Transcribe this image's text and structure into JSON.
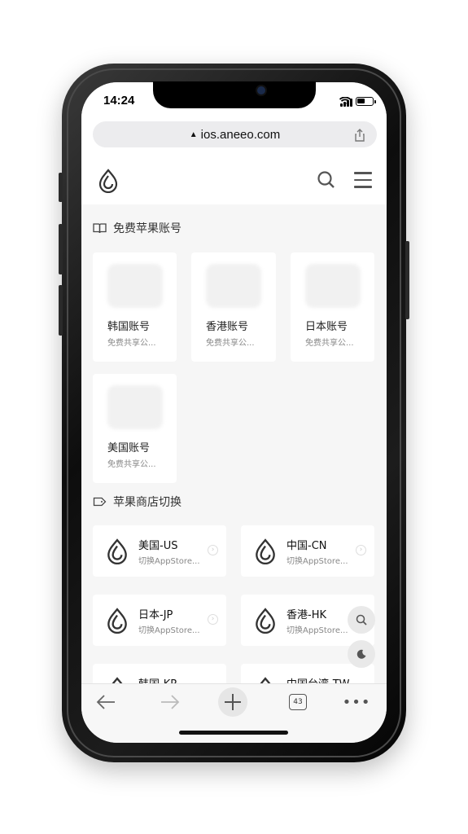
{
  "status_bar": {
    "time": "14:24"
  },
  "browser": {
    "url": "ios.aneeo.com",
    "tabs_count": "43"
  },
  "sections": {
    "free_accounts": {
      "title": "免费苹果账号",
      "cards": [
        {
          "name": "韩国账号",
          "desc": "免费共享公..."
        },
        {
          "name": "香港账号",
          "desc": "免费共享公..."
        },
        {
          "name": "日本账号",
          "desc": "免费共享公..."
        },
        {
          "name": "美国账号",
          "desc": "免费共享公..."
        }
      ]
    },
    "store_switch": {
      "title": "苹果商店切换",
      "items": [
        {
          "name": "美国-US",
          "desc": "切换AppStore..."
        },
        {
          "name": "中国-CN",
          "desc": "切换AppStore..."
        },
        {
          "name": "日本-JP",
          "desc": "切换AppStore..."
        },
        {
          "name": "香港-HK",
          "desc": "切换AppStore..."
        },
        {
          "name": "韩国-KR",
          "desc": ""
        },
        {
          "name": "中国台湾-TW",
          "desc": ""
        }
      ]
    }
  },
  "icons": {
    "logo": "droplet-logo-icon",
    "search": "search-icon",
    "menu": "hamburger-menu-icon",
    "back": "arrow-left-icon",
    "forward": "arrow-right-icon",
    "new_tab": "plus-icon",
    "more": "ellipsis-icon",
    "dark_mode": "moon-icon"
  },
  "colors": {
    "page_bg": "#f6f6f6",
    "card_bg": "#ffffff",
    "text": "#222222",
    "muted": "#888888"
  }
}
